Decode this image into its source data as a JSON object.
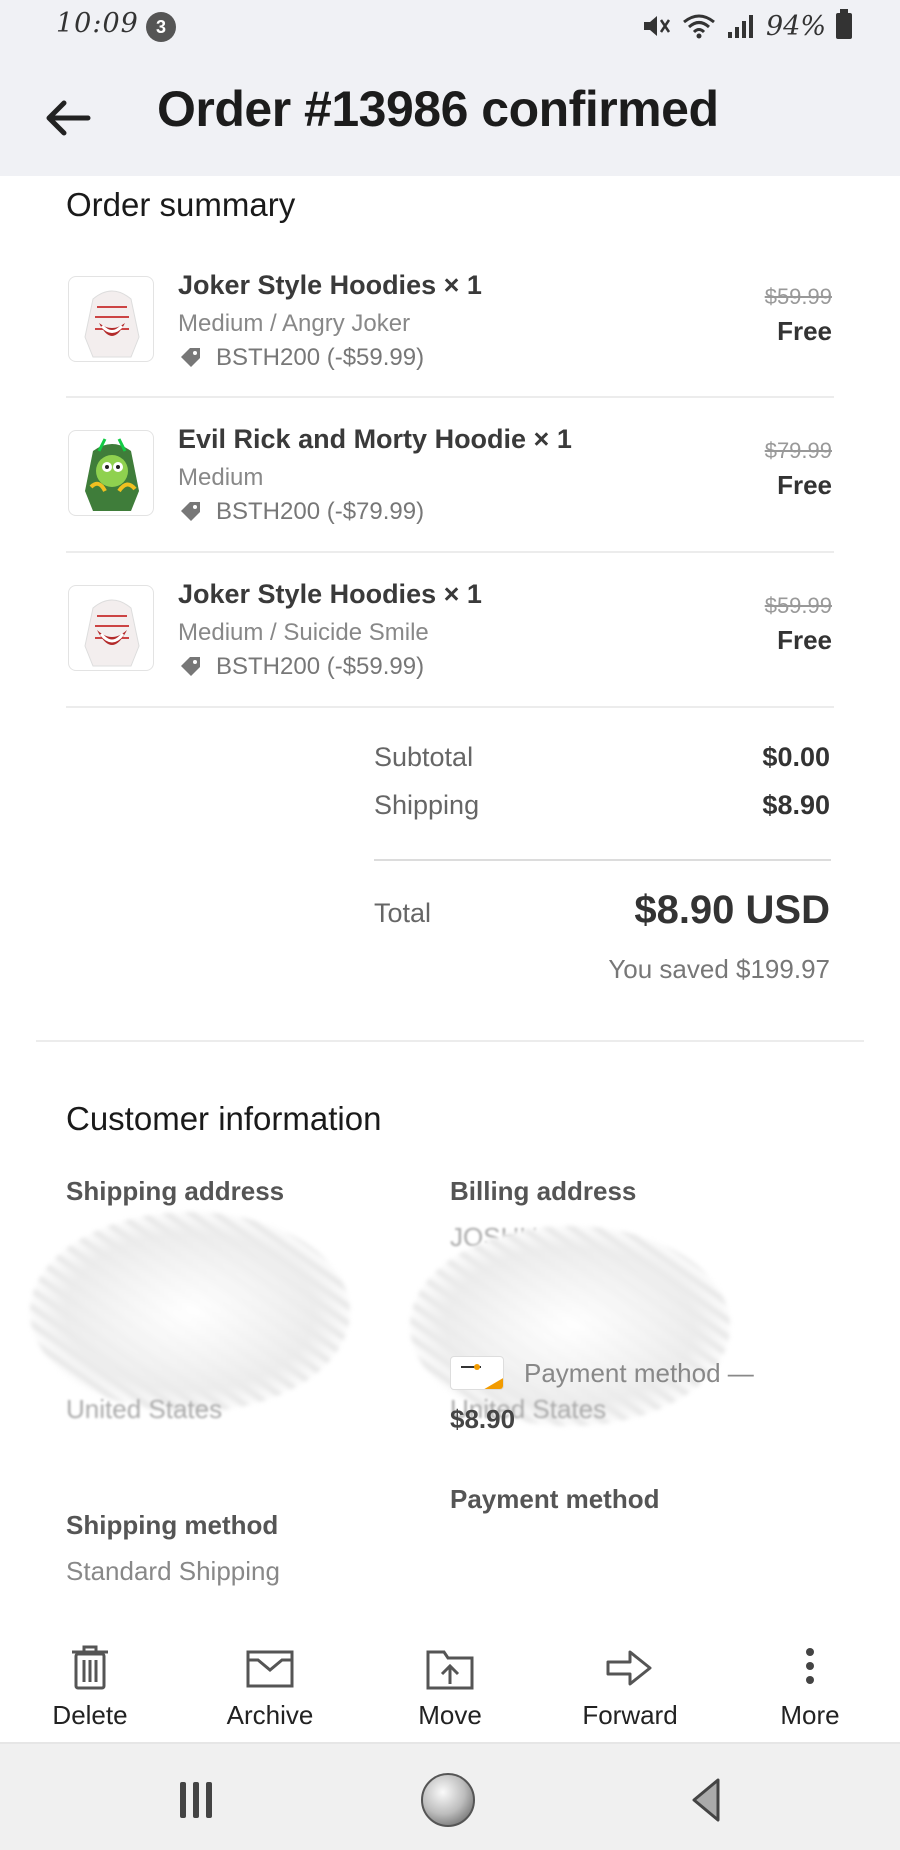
{
  "status_bar": {
    "time": "10:09",
    "notification_count": "3",
    "battery": "94%"
  },
  "header": {
    "title": "Order #13986 confirmed"
  },
  "order_summary": {
    "title": "Order summary",
    "items": [
      {
        "name": "Joker Style Hoodies × 1",
        "variant": "Medium / Angry Joker",
        "discount": "BSTH200 (-$59.99)",
        "original_price": "$59.99",
        "price": "Free"
      },
      {
        "name": "Evil Rick and Morty Hoodie × 1",
        "variant": "Medium",
        "discount": "BSTH200 (-$79.99)",
        "original_price": "$79.99",
        "price": "Free"
      },
      {
        "name": "Joker Style Hoodies × 1",
        "variant": "Medium / Suicide Smile",
        "discount": "BSTH200 (-$59.99)",
        "original_price": "$59.99",
        "price": "Free"
      }
    ],
    "subtotal_label": "Subtotal",
    "subtotal_value": "$0.00",
    "shipping_label": "Shipping",
    "shipping_value": "$8.90",
    "total_label": "Total",
    "total_value": "$8.90 USD",
    "saved_text": "You saved $199.97"
  },
  "customer_info": {
    "title": "Customer information",
    "shipping_address_label": "Shipping address",
    "shipping_address_country": "United States",
    "billing_address_label": "Billing address",
    "billing_address_name": "JOSHU",
    "billing_address_country": "United States",
    "shipping_method_label": "Shipping method",
    "shipping_method_value": "Standard Shipping",
    "payment_method_label": "Payment method",
    "payment_method_text": "Payment method —",
    "payment_amount": "$8.90"
  },
  "action_bar": {
    "delete": "Delete",
    "archive": "Archive",
    "move": "Move",
    "forward": "Forward",
    "more": "More"
  },
  "colors": {
    "header_bg": "#f0f1f5",
    "text_dark": "#1c1c1c",
    "text_muted": "#888888"
  }
}
